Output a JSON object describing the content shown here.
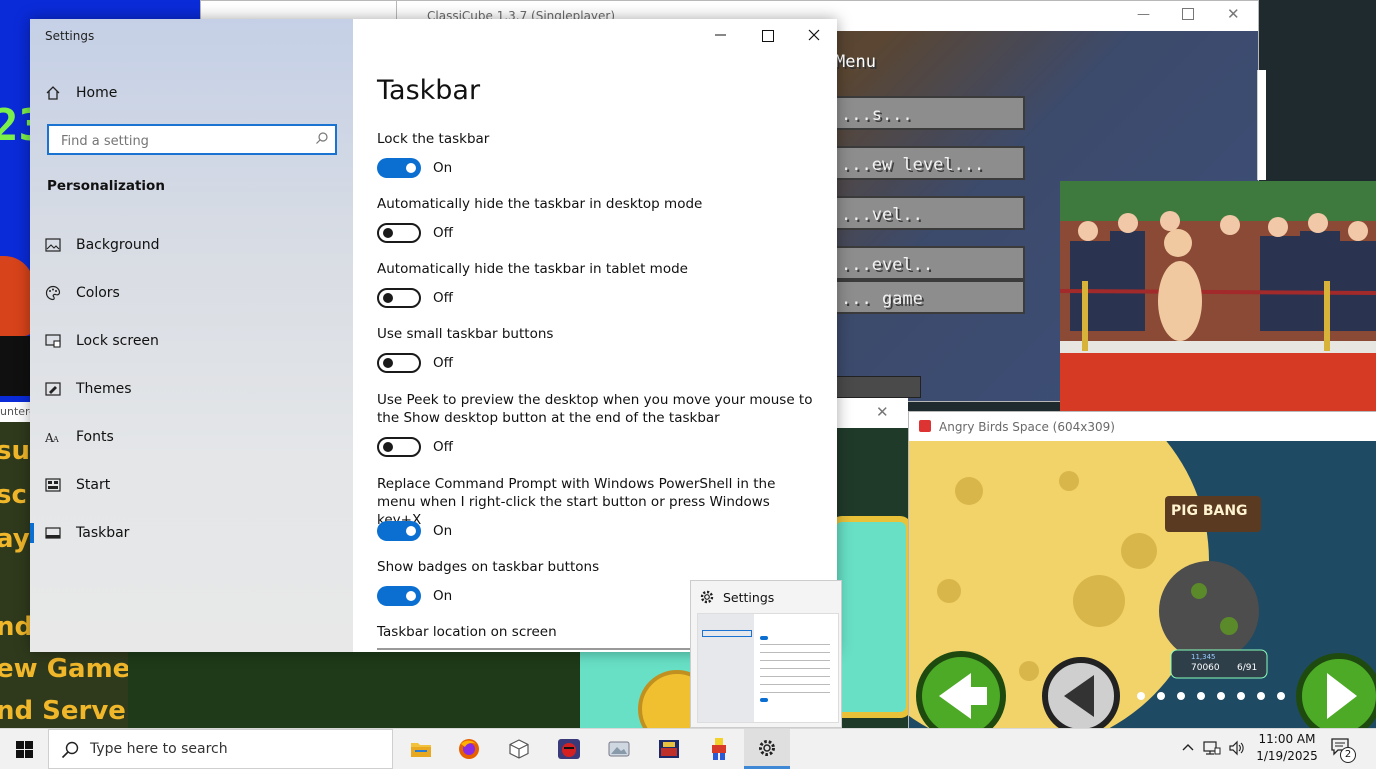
{
  "background_windows": {
    "classicube": {
      "title": "ClassiCube 1.3.7 (Singleplayer)",
      "heading": "Menu",
      "buttons": [
        "...s...",
        "...ew level...",
        "...vel..",
        "...evel..",
        "... game"
      ]
    },
    "left_game": {
      "big_digits": "23",
      "lines": [
        "su",
        "sc",
        "aye",
        "nd",
        "ew Game",
        "nd Servers"
      ],
      "title_fragment": "unter-"
    },
    "angry_birds": {
      "title": "Angry Birds Space (604x309)",
      "sign": "PIG BANG",
      "score": "70060",
      "level": "6/91",
      "score_label": "11,345"
    }
  },
  "settings": {
    "window_title": "Settings",
    "nav": {
      "home": "Home",
      "search_placeholder": "Find a setting",
      "section": "Personalization",
      "items": [
        {
          "label": "Background",
          "icon": "picture-icon"
        },
        {
          "label": "Colors",
          "icon": "palette-icon"
        },
        {
          "label": "Lock screen",
          "icon": "lock-screen-icon"
        },
        {
          "label": "Themes",
          "icon": "themes-icon"
        },
        {
          "label": "Fonts",
          "icon": "fonts-icon"
        },
        {
          "label": "Start",
          "icon": "start-icon"
        },
        {
          "label": "Taskbar",
          "icon": "taskbar-icon"
        }
      ],
      "selected": "Taskbar"
    },
    "page_title": "Taskbar",
    "options": [
      {
        "label": "Lock the taskbar",
        "state": "On",
        "on": true
      },
      {
        "label": "Automatically hide the taskbar in desktop mode",
        "state": "Off",
        "on": false
      },
      {
        "label": "Automatically hide the taskbar in tablet mode",
        "state": "Off",
        "on": false
      },
      {
        "label": "Use small taskbar buttons",
        "state": "Off",
        "on": false
      },
      {
        "label": "Use Peek to preview the desktop when you move your mouse to the Show desktop button at the end of the taskbar",
        "state": "Off",
        "on": false
      },
      {
        "label": "Replace Command Prompt with Windows PowerShell in the menu when I right-click the start button or press Windows key+X",
        "state": "On",
        "on": true
      },
      {
        "label": "Show badges on taskbar buttons",
        "state": "On",
        "on": true
      }
    ],
    "location_label": "Taskbar location on screen"
  },
  "thumbnail": {
    "title": "Settings"
  },
  "taskbar": {
    "search_placeholder": "Type here to search",
    "apps": [
      "file-explorer-icon",
      "firefox-icon",
      "box-app-icon",
      "angry-birds-icon",
      "photos-app-icon",
      "game-app-icon",
      "lego-app-icon",
      "settings-icon"
    ],
    "time": "11:00 AM",
    "date": "1/19/2025",
    "notification_count": "2",
    "accent": "#0a6fd1"
  }
}
